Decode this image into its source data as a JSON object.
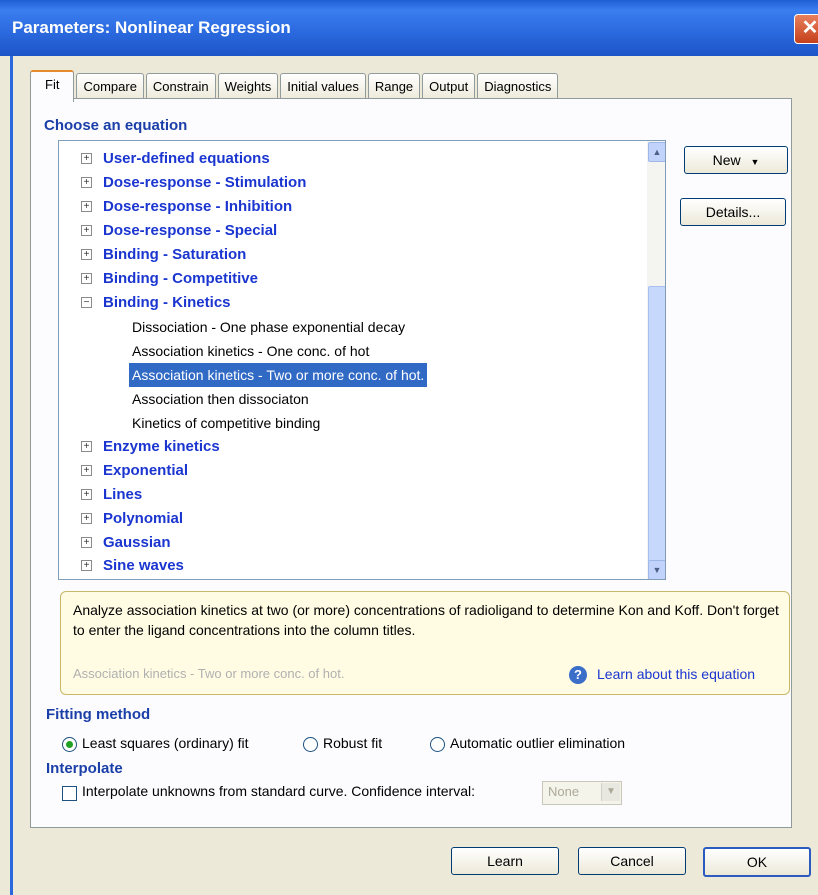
{
  "window": {
    "title": "Parameters: Nonlinear Regression",
    "close_glyph": "✕"
  },
  "tabs": [
    {
      "label": "Fit"
    },
    {
      "label": "Compare"
    },
    {
      "label": "Constrain"
    },
    {
      "label": "Weights"
    },
    {
      "label": "Initial values"
    },
    {
      "label": "Range"
    },
    {
      "label": "Output"
    },
    {
      "label": "Diagnostics"
    }
  ],
  "equation": {
    "heading": "Choose an equation",
    "categories": [
      {
        "label": "User-defined equations",
        "expanded": false
      },
      {
        "label": "Dose-response - Stimulation",
        "expanded": false
      },
      {
        "label": "Dose-response - Inhibition",
        "expanded": false
      },
      {
        "label": "Dose-response - Special",
        "expanded": false
      },
      {
        "label": "Binding - Saturation",
        "expanded": false
      },
      {
        "label": "Binding - Competitive",
        "expanded": false
      },
      {
        "label": "Binding - Kinetics",
        "expanded": true
      },
      {
        "label": "Enzyme kinetics",
        "expanded": false
      },
      {
        "label": "Exponential",
        "expanded": false
      },
      {
        "label": "Lines",
        "expanded": false
      },
      {
        "label": "Polynomial",
        "expanded": false
      },
      {
        "label": "Gaussian",
        "expanded": false
      },
      {
        "label": "Sine waves",
        "expanded": false
      }
    ],
    "kinetics_children": [
      {
        "label": "Dissociation - One phase exponential decay",
        "selected": false
      },
      {
        "label": "Association kinetics - One conc. of hot",
        "selected": false
      },
      {
        "label": "Association kinetics - Two or more conc. of hot.",
        "selected": true
      },
      {
        "label": "Association then dissociaton",
        "selected": false
      },
      {
        "label": "Kinetics of competitive binding",
        "selected": false
      }
    ],
    "new_button": "New",
    "details_button": "Details..."
  },
  "description": {
    "text": "Analyze association kinetics at two (or more) concentrations of radioligand to determine Kon and Koff. Don't forget to enter the ligand concentrations into the column titles.",
    "equation_name": "Association kinetics - Two or more conc. of hot.",
    "learn_link": "Learn about this equation"
  },
  "fitting": {
    "heading": "Fitting method",
    "options": [
      {
        "label": "Least squares (ordinary) fit",
        "checked": true
      },
      {
        "label": "Robust fit",
        "checked": false
      },
      {
        "label": "Automatic outlier elimination",
        "checked": false
      }
    ]
  },
  "interpolate": {
    "heading": "Interpolate",
    "checkbox_label": "Interpolate unknowns from standard curve. Confidence interval:",
    "checked": false,
    "interval_value": "None"
  },
  "footer": {
    "learn": "Learn",
    "cancel": "Cancel",
    "ok": "OK"
  },
  "colors": {
    "title_bar": "#2a68dd",
    "heading": "#1b3fa8",
    "category": "#1a35d0",
    "selection": "#316ac5"
  }
}
